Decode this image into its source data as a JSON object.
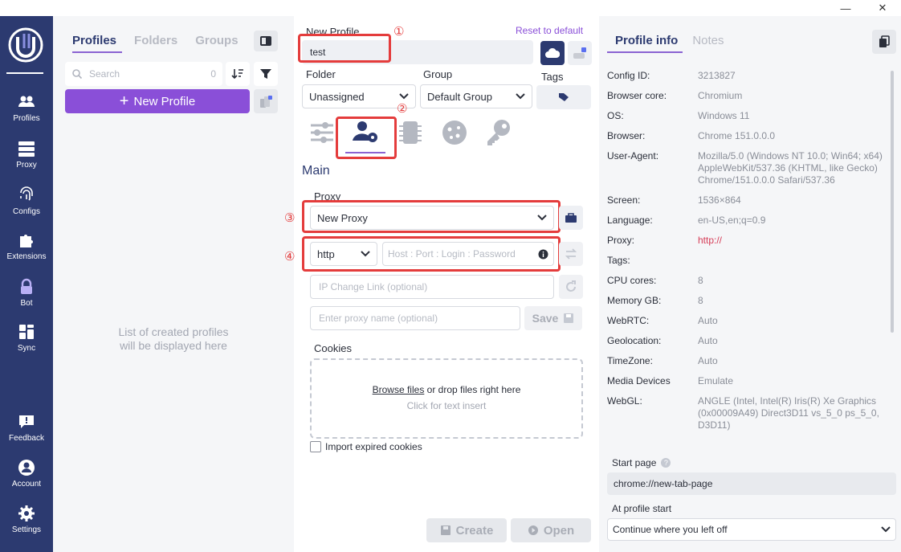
{
  "window": {
    "minimize": "—",
    "close": "✕"
  },
  "rail": {
    "items": [
      {
        "label": "Profiles",
        "icon": "profiles-icon"
      },
      {
        "label": "Proxy",
        "icon": "proxy-icon"
      },
      {
        "label": "Configs",
        "icon": "fingerprint-icon"
      },
      {
        "label": "Extensions",
        "icon": "puzzle-icon"
      },
      {
        "label": "Bot",
        "icon": "lock-icon"
      },
      {
        "label": "Sync",
        "icon": "sync-icon"
      },
      {
        "label": "Feedback",
        "icon": "feedback-icon"
      },
      {
        "label": "Account",
        "icon": "account-icon"
      },
      {
        "label": "Settings",
        "icon": "gear-icon"
      }
    ]
  },
  "profiles_panel": {
    "tabs": [
      "Profiles",
      "Folders",
      "Groups"
    ],
    "search_placeholder": "Search",
    "search_count": "0",
    "new_profile": "New Profile",
    "empty_line1": "List of created profiles",
    "empty_line2": "will be displayed here"
  },
  "editor": {
    "name_label": "New Profile",
    "reset": "Reset to default",
    "name_value": "test",
    "folder_label": "Folder",
    "folder_value": "Unassigned",
    "group_label": "Group",
    "group_value": "Default Group",
    "tags_label": "Tags",
    "section_title": "Main",
    "proxy_label": "Proxy",
    "proxy_value": "New Proxy",
    "proxy_type": "http",
    "host_placeholder": "Host : Port : Login : Password",
    "ip_change_placeholder": "IP Change Link (optional)",
    "proxy_name_placeholder": "Enter proxy name (optional)",
    "save": "Save",
    "cookies_label": "Cookies",
    "browse": "Browse files",
    "drop_text": " or drop files right here",
    "click_text": "Click for text insert",
    "import_expired": "Import expired cookies",
    "create": "Create",
    "open": "Open",
    "markers": [
      "①",
      "②",
      "③",
      "④"
    ]
  },
  "info_panel": {
    "tabs": [
      "Profile info",
      "Notes"
    ],
    "rows": [
      {
        "k": "Config ID:",
        "v": "3213827"
      },
      {
        "k": "Browser core:",
        "v": "Chromium"
      },
      {
        "k": "OS:",
        "v": "Windows 11"
      },
      {
        "k": "Browser:",
        "v": "Chrome 151.0.0.0"
      },
      {
        "k": "User-Agent:",
        "v": "Mozilla/5.0 (Windows NT 10.0; Win64; x64) AppleWebKit/537.36 (KHTML, like Gecko) Chrome/151.0.0.0 Safari/537.36"
      },
      {
        "k": "Screen:",
        "v": "1536×864"
      },
      {
        "k": "Language:",
        "v": "en-US,en;q=0.9"
      },
      {
        "k": "Proxy:",
        "v": "http://"
      },
      {
        "k": "Tags:",
        "v": ""
      },
      {
        "k": "CPU cores:",
        "v": "8"
      },
      {
        "k": "Memory GB:",
        "v": "8"
      },
      {
        "k": "WebRTC:",
        "v": "Auto"
      },
      {
        "k": "Geolocation:",
        "v": "Auto"
      },
      {
        "k": "TimeZone:",
        "v": "Auto"
      },
      {
        "k": "Media Devices",
        "v": "Emulate"
      },
      {
        "k": "WebGL:",
        "v": "ANGLE (Intel, Intel(R) Iris(R) Xe Graphics (0x00009A49) Direct3D11 vs_5_0 ps_5_0, D3D11)"
      }
    ],
    "start_page_label": "Start page",
    "start_page_help": "?",
    "start_page_value": "chrome://new-tab-page",
    "at_start_label": "At profile start",
    "at_start_value": "Continue where you left off"
  },
  "colors": {
    "rail": "#2c3a70",
    "accent": "#8a4fd8",
    "annotation": "#e43c3c",
    "proxy_value": "#d63d57"
  }
}
